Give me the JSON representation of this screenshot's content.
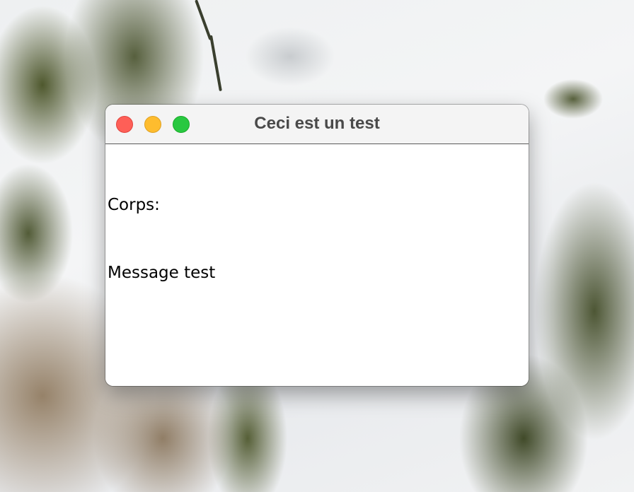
{
  "window": {
    "title": "Ceci est un test",
    "controls": {
      "close_icon": "close-icon",
      "minimize_icon": "minimize-icon",
      "zoom_icon": "zoom-icon"
    }
  },
  "content": {
    "lines": [
      "Corps:",
      "Message test"
    ]
  },
  "colors": {
    "close": "#fe5f57",
    "minimize": "#febc2e",
    "zoom": "#28c840",
    "title_text": "#4a4a4a"
  }
}
